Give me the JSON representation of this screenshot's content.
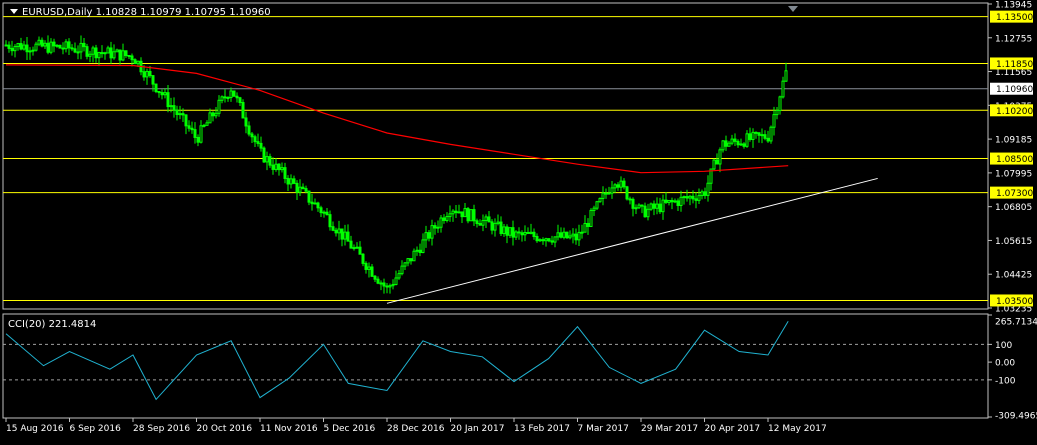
{
  "header": {
    "symbol_line": "EURUSD,Daily  1.10828 1.10979 1.10795 1.10960"
  },
  "indicator": {
    "label": "CCI(20) 221.4814"
  },
  "colors": {
    "background": "#000000",
    "frame": "#c0c0c0",
    "candle": "#00ff00",
    "moving_average": "#ff0000",
    "level_line": "#ffff00",
    "trendline": "#ffffff",
    "cci_line": "#20b2d0",
    "level_badge": "#ffff00",
    "current_badge": "#ffffff"
  },
  "chart_data": [
    {
      "type": "candlestick",
      "title": "EURUSD,Daily",
      "ohlc_last": {
        "open": 1.10828,
        "high": 1.10979,
        "low": 1.10795,
        "close": 1.1096
      },
      "ylim": [
        1.03235,
        1.13945
      ],
      "y_ticks": [
        "1.13945",
        "1.12755",
        "1.11565",
        "1.10375",
        "1.09185",
        "1.07995",
        "1.06805",
        "1.05615",
        "1.04425",
        "1.03235"
      ],
      "x_ticks": [
        "15 Aug 2016",
        "6 Sep 2016",
        "28 Sep 2016",
        "20 Oct 2016",
        "11 Nov 2016",
        "5 Dec 2016",
        "28 Dec 2016",
        "20 Jan 2017",
        "13 Feb 2017",
        "7 Mar 2017",
        "29 Mar 2017",
        "20 Apr 2017",
        "12 May 2017"
      ],
      "horizontal_levels": [
        "1.13500",
        "1.11850",
        "1.10200",
        "1.08500",
        "1.07300",
        "1.03500"
      ],
      "current_price": "1.10960",
      "price_path": [
        [
          "15 Aug 2016",
          1.125
        ],
        [
          "6 Sep 2016",
          1.124
        ],
        [
          "28 Sep 2016",
          1.121
        ],
        [
          "20 Oct 2016",
          1.092
        ],
        [
          "1 Nov 2016",
          1.11
        ],
        [
          "11 Nov 2016",
          1.087
        ],
        [
          "5 Dec 2016",
          1.066
        ],
        [
          "28 Dec 2016",
          1.039
        ],
        [
          "20 Jan 2017",
          1.068
        ],
        [
          "13 Feb 2017",
          1.058
        ],
        [
          "7 Mar 2017",
          1.057
        ],
        [
          "20 Mar 2017",
          1.078
        ],
        [
          "29 Mar 2017",
          1.066
        ],
        [
          "20 Apr 2017",
          1.073
        ],
        [
          "26 Apr 2017",
          1.09
        ],
        [
          "12 May 2017",
          1.093
        ],
        [
          "19 May 2017",
          1.118
        ]
      ],
      "moving_average": [
        [
          "15 Aug 2016",
          1.118
        ],
        [
          "28 Sep 2016",
          1.1178
        ],
        [
          "20 Oct 2016",
          1.115
        ],
        [
          "11 Nov 2016",
          1.109
        ],
        [
          "5 Dec 2016",
          1.101
        ],
        [
          "28 Dec 2016",
          1.094
        ],
        [
          "20 Jan 2017",
          1.09
        ],
        [
          "13 Feb 2017",
          1.0865
        ],
        [
          "7 Mar 2017",
          1.083
        ],
        [
          "29 Mar 2017",
          1.08
        ],
        [
          "20 Apr 2017",
          1.0805
        ],
        [
          "19 May 2017",
          1.0825
        ]
      ],
      "trendline": [
        [
          "28 Dec 2016",
          1.034
        ],
        [
          "19 Jun 2017",
          1.078
        ]
      ]
    },
    {
      "type": "line",
      "title": "CCI(20) 221.4814",
      "ylim": [
        -309.4965,
        265.7134
      ],
      "y_ticks": [
        "265.7134",
        "100",
        "0.00",
        "-100",
        "-309.4965"
      ],
      "reference_levels": [
        100,
        -100
      ],
      "x": [
        "15 Aug 2016",
        "28 Aug 2016",
        "6 Sep 2016",
        "20 Sep 2016",
        "28 Sep 2016",
        "6 Oct 2016",
        "20 Oct 2016",
        "1 Nov 2016",
        "11 Nov 2016",
        "22 Nov 2016",
        "5 Dec 2016",
        "14 Dec 2016",
        "28 Dec 2016",
        "10 Jan 2017",
        "20 Jan 2017",
        "1 Feb 2017",
        "13 Feb 2017",
        "25 Feb 2017",
        "7 Mar 2017",
        "18 Mar 2017",
        "29 Mar 2017",
        "10 Apr 2017",
        "20 Apr 2017",
        "2 May 2017",
        "12 May 2017",
        "19 May 2017"
      ],
      "values": [
        160,
        -20,
        60,
        -40,
        40,
        -210,
        40,
        120,
        -200,
        -90,
        100,
        -120,
        -160,
        120,
        60,
        30,
        -110,
        20,
        200,
        -30,
        -120,
        -40,
        180,
        60,
        40,
        230
      ]
    }
  ]
}
